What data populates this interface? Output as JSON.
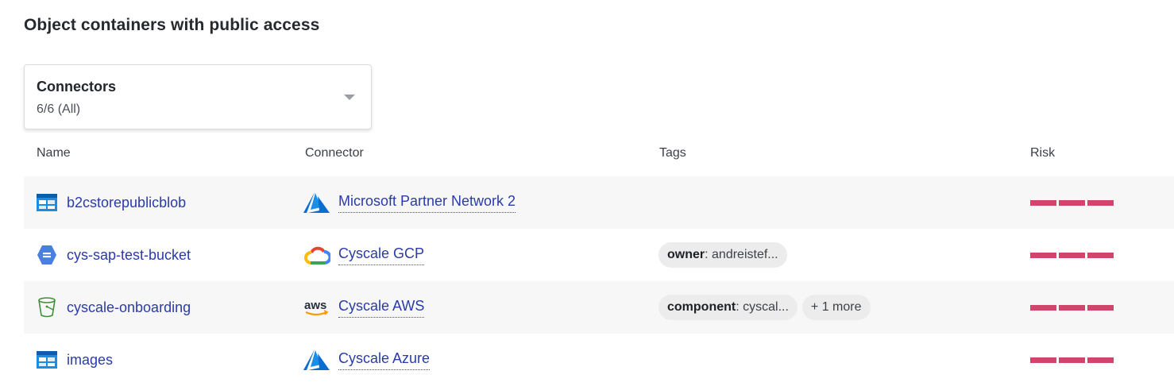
{
  "page": {
    "title": "Object containers with public access"
  },
  "filter": {
    "label": "Connectors",
    "value": "6/6 (All)"
  },
  "table": {
    "columns": {
      "name": "Name",
      "connector": "Connector",
      "tags": "Tags",
      "risk": "Risk"
    },
    "rows": [
      {
        "name": "b2cstorepublicblob",
        "name_icon": "azure-storage-icon",
        "connector": "Microsoft Partner Network 2",
        "connector_icon": "azure-logo-icon",
        "tags": [],
        "risk": 3
      },
      {
        "name": "cys-sap-test-bucket",
        "name_icon": "gcp-storage-icon",
        "connector": "Cyscale GCP",
        "connector_icon": "gcp-logo-icon",
        "tags": [
          {
            "key": "owner",
            "value": ": andreistef..."
          }
        ],
        "risk": 3
      },
      {
        "name": "cyscale-onboarding",
        "name_icon": "s3-bucket-icon",
        "connector": "Cyscale AWS",
        "connector_icon": "aws-logo-icon",
        "tags": [
          {
            "key": "component",
            "value": ": cyscal..."
          }
        ],
        "more": "+ 1 more",
        "risk": 3
      },
      {
        "name": "images",
        "name_icon": "azure-storage-icon",
        "connector": "Cyscale Azure",
        "connector_icon": "azure-logo-icon",
        "tags": [],
        "risk": 3
      }
    ]
  },
  "colors": {
    "link": "#2a3ba8",
    "risk": "#d1446b",
    "row_shade": "#f7f7f7"
  }
}
